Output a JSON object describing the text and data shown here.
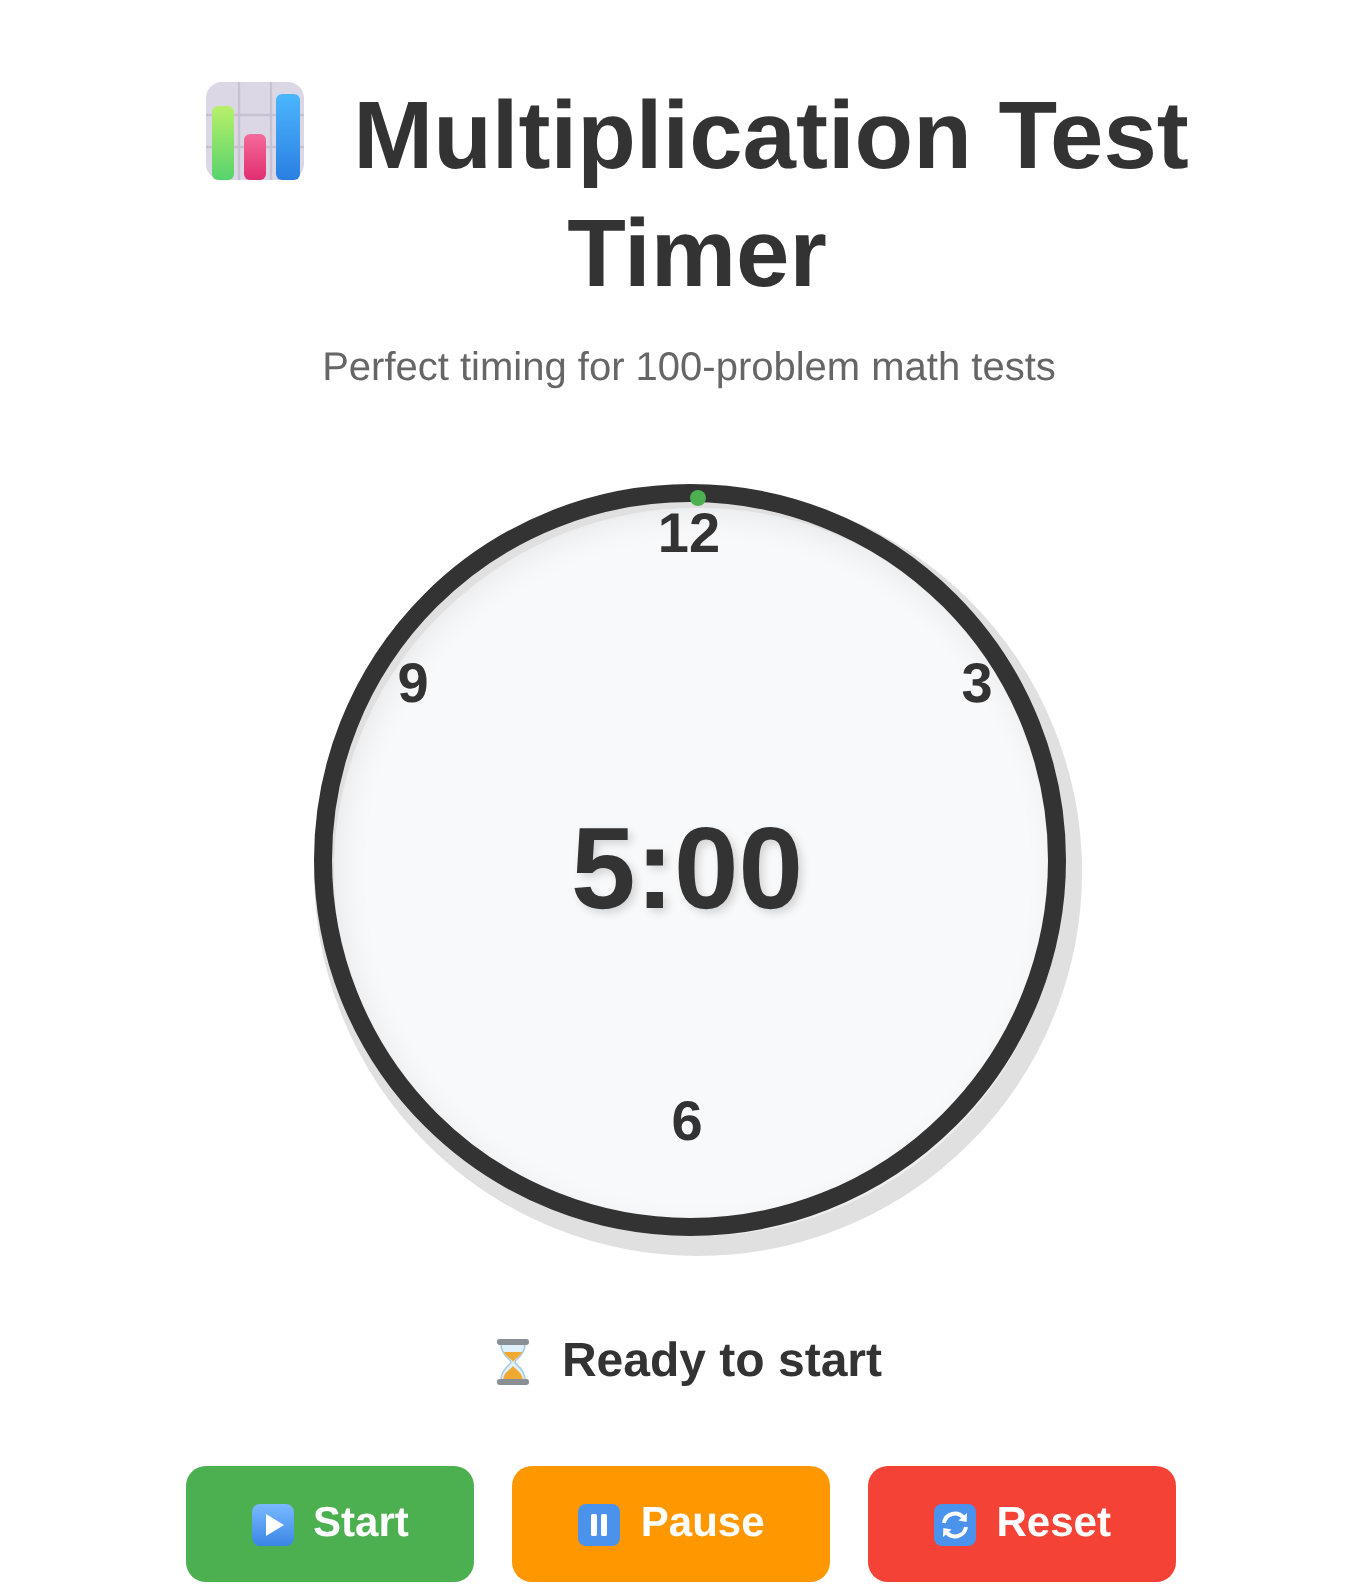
{
  "header": {
    "title": "Multiplication Test Timer",
    "subtitle": "Perfect timing for 100-problem math tests"
  },
  "clock": {
    "numbers": [
      "12",
      "3",
      "6",
      "9"
    ],
    "progress": {
      "level": 1
    },
    "time": "5:00"
  },
  "status": {
    "kind": "ready",
    "text": "Ready to start"
  },
  "buttons": [
    {
      "kind": "start",
      "label": "Start"
    },
    {
      "kind": "pause",
      "label": "Pause"
    },
    {
      "kind": "reset",
      "label": "Reset"
    }
  ]
}
